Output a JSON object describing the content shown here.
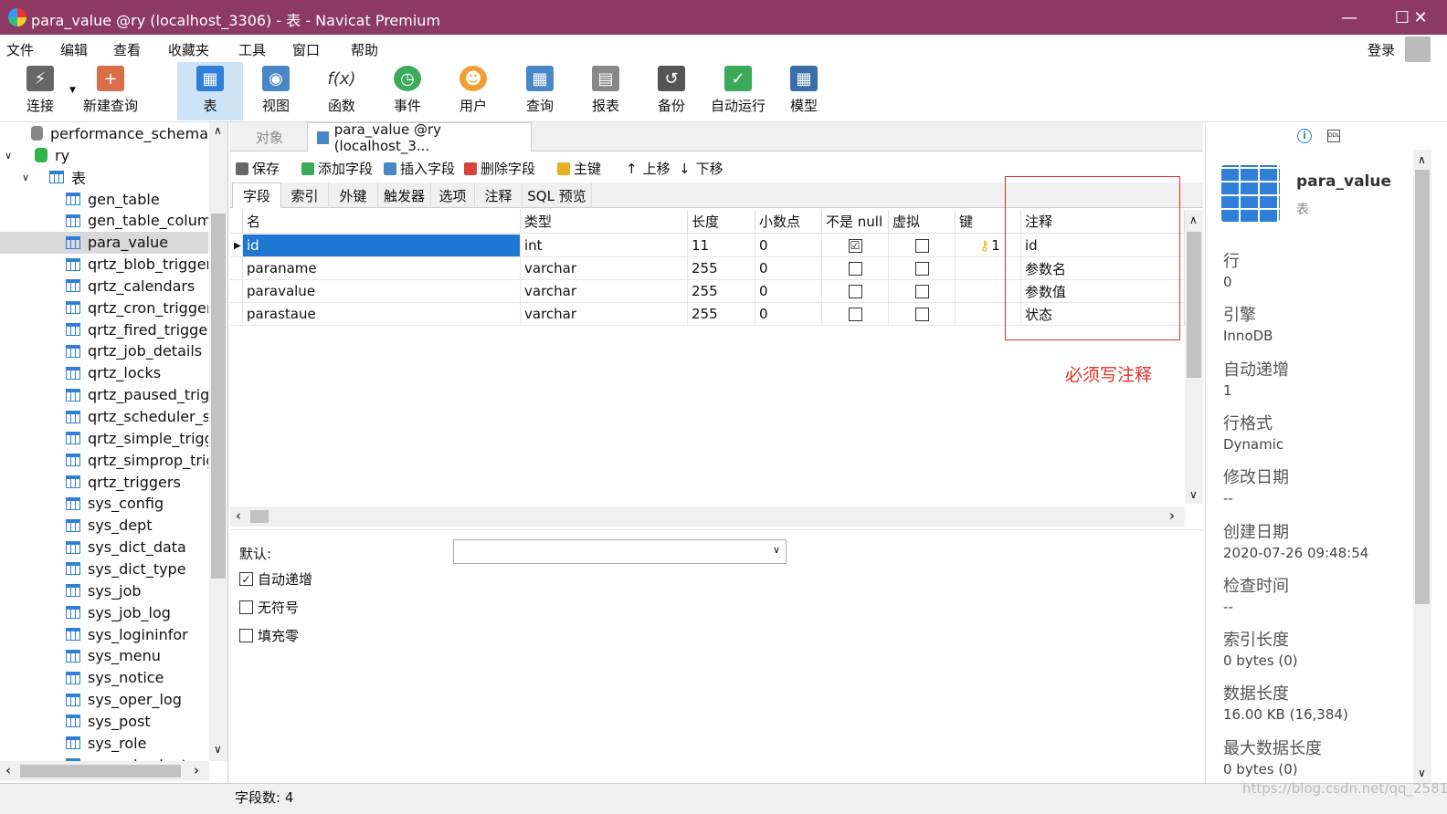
{
  "window": {
    "title": "para_value @ry (localhost_3306) - 表 - Navicat Premium"
  },
  "menu": [
    "文件",
    "编辑",
    "查看",
    "收藏夹",
    "工具",
    "窗口",
    "帮助"
  ],
  "login_label": "登录",
  "toolbar": [
    "连接",
    "新建查询",
    "表",
    "视图",
    "函数",
    "事件",
    "用户",
    "查询",
    "报表",
    "备份",
    "自动运行",
    "模型"
  ],
  "tree": {
    "schema": "performance_schema",
    "db": "ry",
    "tables_node": "表",
    "tables": [
      "gen_table",
      "gen_table_column",
      "para_value",
      "qrtz_blob_triggers",
      "qrtz_calendars",
      "qrtz_cron_triggers",
      "qrtz_fired_triggers",
      "qrtz_job_details",
      "qrtz_locks",
      "qrtz_paused_trigge",
      "qrtz_scheduler_sta",
      "qrtz_simple_trigge",
      "qrtz_simprop_trigg",
      "qrtz_triggers",
      "sys_config",
      "sys_dept",
      "sys_dict_data",
      "sys_dict_type",
      "sys_job",
      "sys_job_log",
      "sys_logininfor",
      "sys_menu",
      "sys_notice",
      "sys_oper_log",
      "sys_post",
      "sys_role",
      "sys_role_dept"
    ]
  },
  "tabs": {
    "objects": "对象",
    "editor": "para_value @ry (localhost_3..."
  },
  "field_toolbar": [
    "保存",
    "添加字段",
    "插入字段",
    "删除字段",
    "主键",
    "上移",
    "下移"
  ],
  "subtabs": [
    "字段",
    "索引",
    "外键",
    "触发器",
    "选项",
    "注释",
    "SQL 预览"
  ],
  "columns": [
    "名",
    "类型",
    "长度",
    "小数点",
    "不是 null",
    "虚拟",
    "键",
    "注释"
  ],
  "rows": [
    {
      "name": "id",
      "type": "int",
      "length": "11",
      "decimals": "0",
      "notnull": "☑",
      "virtual": "",
      "key": "1",
      "comment": "id"
    },
    {
      "name": "paraname",
      "type": "varchar",
      "length": "255",
      "decimals": "0",
      "notnull": "",
      "virtual": "",
      "key": "",
      "comment": "参数名"
    },
    {
      "name": "paravalue",
      "type": "varchar",
      "length": "255",
      "decimals": "0",
      "notnull": "",
      "virtual": "",
      "key": "",
      "comment": "参数值"
    },
    {
      "name": "parastaue",
      "type": "varchar",
      "length": "255",
      "decimals": "0",
      "notnull": "",
      "virtual": "",
      "key": "",
      "comment": "状态"
    }
  ],
  "annotation": "必须写注释",
  "bottom": {
    "default_label": "默认:",
    "auto_increment": "自动递增",
    "unsigned": "无符号",
    "zerofill": "填充零"
  },
  "props": {
    "table_name": "para_value",
    "table_type": "表",
    "items": [
      {
        "label": "行",
        "value": "0"
      },
      {
        "label": "引擎",
        "value": "InnoDB"
      },
      {
        "label": "自动递增",
        "value": "1"
      },
      {
        "label": "行格式",
        "value": "Dynamic"
      },
      {
        "label": "修改日期",
        "value": "--"
      },
      {
        "label": "创建日期",
        "value": "2020-07-26 09:48:54"
      },
      {
        "label": "检查时间",
        "value": "--"
      },
      {
        "label": "索引长度",
        "value": "0 bytes (0)"
      },
      {
        "label": "数据长度",
        "value": "16.00 KB (16,384)"
      },
      {
        "label": "最大数据长度",
        "value": "0 bytes (0)"
      }
    ]
  },
  "status": {
    "field_count": "字段数: 4"
  },
  "watermark": "https://blog.csdn.net/qq_2581",
  "colors": {
    "titlebar": "#8c3a62",
    "accent": "#2f7fd8",
    "selected": "#1e78d2",
    "annotation": "#e0302a"
  }
}
